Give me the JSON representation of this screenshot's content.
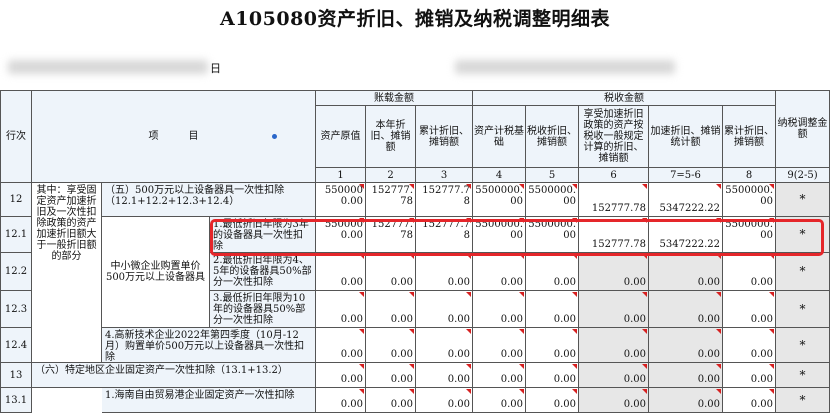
{
  "form_title": "A105080资产折旧、摊销及纳税调整明细表",
  "header_trail": "日",
  "headers": {
    "row_no": "行次",
    "item": "项　　　目",
    "book_group": "账载金额",
    "tax_group": "税收金额",
    "adjust": "纳税调整金额",
    "cols": [
      "资产原值",
      "本年折旧、摊销额",
      "累计折旧、摊销额",
      "资产计税基础",
      "税收折旧、摊销额",
      "享受加速折旧政策的资产按税收一般规定计算的折旧、摊销额",
      "加速折旧、摊销统计额",
      "累计折旧、摊销额"
    ],
    "col_nums": [
      "1",
      "2",
      "3",
      "4",
      "5",
      "6",
      "7=5-6",
      "8",
      "9(2-5)"
    ]
  },
  "group_label": "其中：享受固定资产加速折旧及一次性扣除政策的资产加速折旧额大于一般折旧额的部分",
  "sub_label": "中小微企业购置单价500万元以上设备器具",
  "rows": [
    {
      "no": "12",
      "item": "（五）500万元以上设备器具一次性扣除（12.1+12.2+12.3+12.4）",
      "c1": "5500000.00",
      "c2": "152777.78",
      "c3": "152777.78",
      "c4": "5500000.00",
      "c5": "5500000.00",
      "c6": "152777.78",
      "c7": "5347222.22",
      "c8": "5500000.00",
      "c9": "*"
    },
    {
      "no": "12.1",
      "item": "1.最低折旧年限为3年的设备器具一次性扣除",
      "c1": "5500000.00",
      "c2": "152777.78",
      "c3": "152777.78",
      "c4": "5500000.00",
      "c5": "5500000.00",
      "c6": "152777.78",
      "c7": "5347222.22",
      "c8": "5500000.00",
      "c9": "*"
    },
    {
      "no": "12.2",
      "item": "2.最低折旧年限为4、5年的设备器具50%部分一次性扣除",
      "c1": "0.00",
      "c2": "0.00",
      "c3": "0.00",
      "c4": "0.00",
      "c5": "0.00",
      "c6": "0.00",
      "c7": "0.00",
      "c8": "0.00",
      "c9": "*"
    },
    {
      "no": "12.3",
      "item": "3.最低折旧年限为10年的设备器具50%部分一次性扣除",
      "c1": "0.00",
      "c2": "0.00",
      "c3": "0.00",
      "c4": "0.00",
      "c5": "0.00",
      "c6": "0.00",
      "c7": "0.00",
      "c8": "0.00",
      "c9": "*"
    },
    {
      "no": "12.4",
      "item": "4.高新技术企业2022年第四季度（10月-12月）购置单价500万元以上设备器具一次性扣除",
      "c1": "0.00",
      "c2": "0.00",
      "c3": "0.00",
      "c4": "0.00",
      "c5": "0.00",
      "c6": "0.00",
      "c7": "0.00",
      "c8": "0.00",
      "c9": "*"
    },
    {
      "no": "13",
      "item": "（六）特定地区企业固定资产一次性扣除（13.1+13.2）",
      "c1": "0.00",
      "c2": "0.00",
      "c3": "0.00",
      "c4": "0.00",
      "c5": "0.00",
      "c6": "0.00",
      "c7": "0.00",
      "c8": "0.00",
      "c9": "*"
    },
    {
      "no": "13.1",
      "item": "1.海南自由贸易港企业固定资产一次性扣除",
      "c1": "0.00",
      "c2": "0.00",
      "c3": "0.00",
      "c4": "0.00",
      "c5": "0.00",
      "c6": "0.00",
      "c7": "0.00",
      "c8": "0.00",
      "c9": "*"
    }
  ],
  "colors": {
    "header_bg": "#eef4fa",
    "highlight": "#e5262a",
    "disabled_cell": "#e7e7e7"
  }
}
